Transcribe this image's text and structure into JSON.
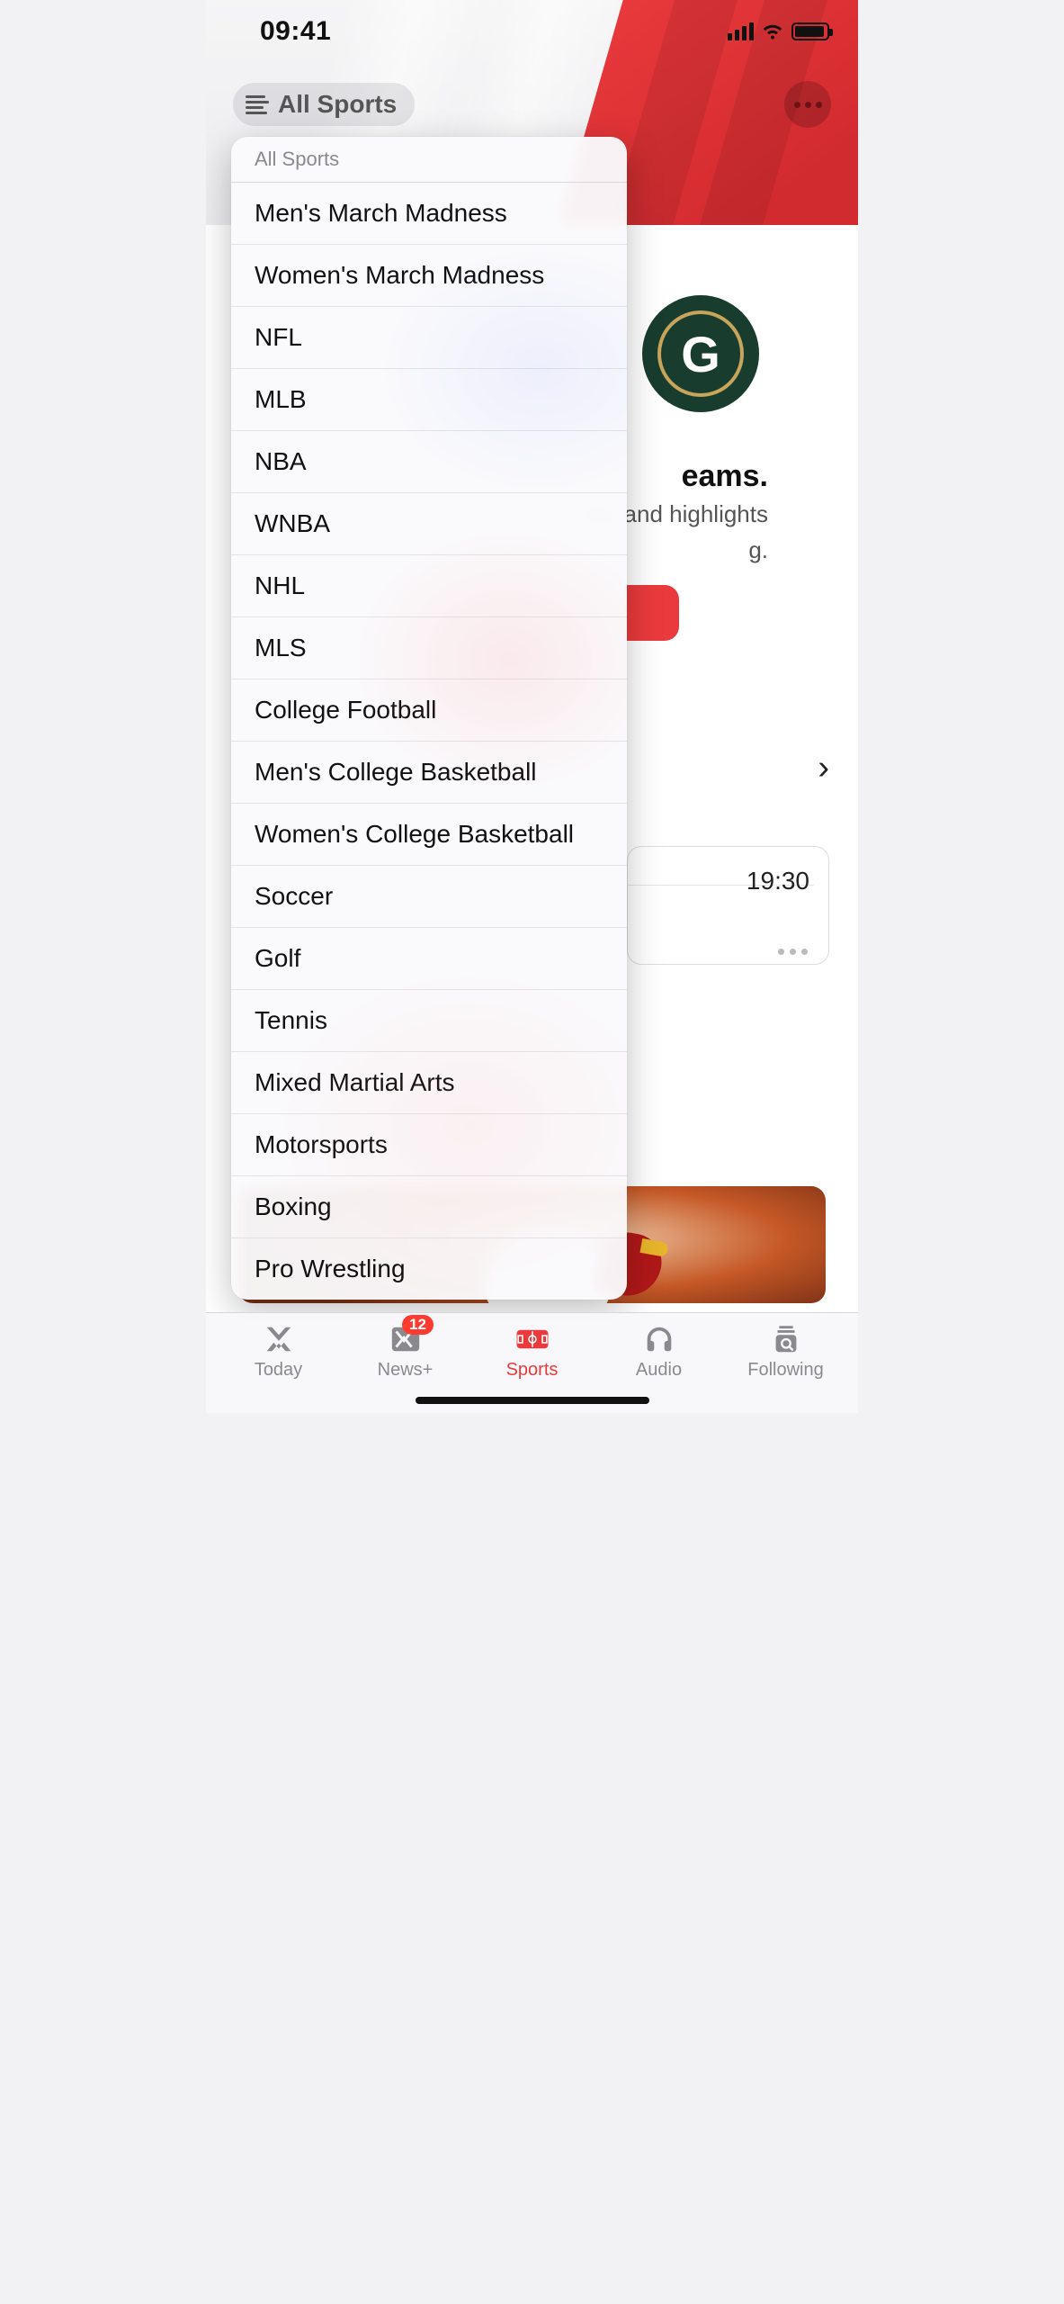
{
  "status": {
    "time": "09:41"
  },
  "header": {
    "pill_label": "All Sports",
    "dropdown_header": "All Sports"
  },
  "dropdown": {
    "items": [
      "Men's March Madness",
      "Women's March Madness",
      "NFL",
      "MLB",
      "NBA",
      "WNBA",
      "NHL",
      "MLS",
      "College Football",
      "Men's College Basketball",
      "Women's College Basketball",
      "Soccer",
      "Golf",
      "Tennis",
      "Mixed Martial Arts",
      "Motorsports",
      "Boxing",
      "Pro Wrestling"
    ]
  },
  "background": {
    "team_initial": "G",
    "headline_fragment": "eams.",
    "body_fragment_1": "es, and highlights",
    "body_fragment_2": "g.",
    "event_time": "19:30"
  },
  "tabbar": {
    "today": "Today",
    "newsplus": "News+",
    "newsplus_badge": "12",
    "sports": "Sports",
    "audio": "Audio",
    "following": "Following"
  }
}
